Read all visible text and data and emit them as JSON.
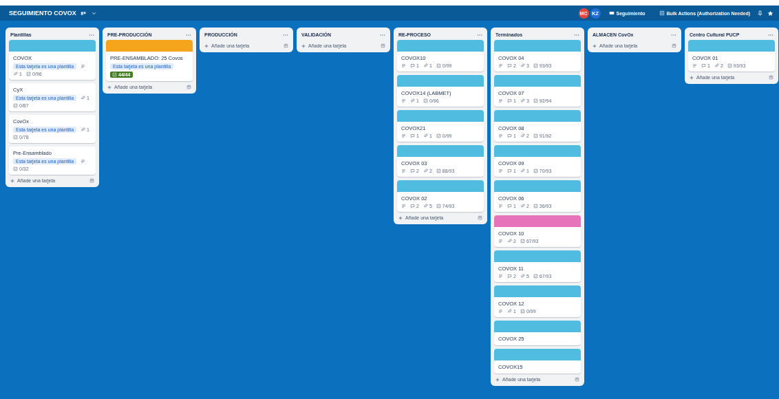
{
  "header": {
    "title": "SEGUIMIENTO COVOX",
    "avatars": [
      {
        "initials": "MC",
        "color": "#e2483d"
      },
      {
        "initials": "KZ",
        "color": "#1f6fd6"
      }
    ],
    "buttons": [
      {
        "kind": "power-up",
        "label": "Seguimiento"
      },
      {
        "kind": "bulk",
        "label": "Bulk Actions (Authorization Needed)"
      }
    ]
  },
  "lists": [
    {
      "title": "Plantillas",
      "add_label": "Añade una tarjeta",
      "cards": [
        {
          "color": "#4fbce0",
          "title": "COVOX",
          "template_badge": "Esta tarjeta es una plantilla",
          "badges": [
            {
              "kind": "description"
            },
            {
              "kind": "attachments",
              "text": "1"
            },
            {
              "kind": "checklist",
              "text": "0/96",
              "complete": false
            }
          ]
        },
        {
          "title": "CyX",
          "template_badge": "Esta tarjeta es una plantilla",
          "badges": [
            {
              "kind": "attachments",
              "text": "1"
            },
            {
              "kind": "checklist",
              "text": "0/87",
              "complete": false
            }
          ]
        },
        {
          "title": "CovOx",
          "template_badge": "Esta tarjeta es una plantilla",
          "badges": [
            {
              "kind": "attachments",
              "text": "1"
            },
            {
              "kind": "checklist",
              "text": "0/78",
              "complete": false
            }
          ]
        },
        {
          "title": "Pre-Ensamblado",
          "template_badge": "Esta tarjeta es una plantilla",
          "badges": [
            {
              "kind": "description"
            },
            {
              "kind": "checklist",
              "text": "0/32",
              "complete": false
            }
          ]
        }
      ]
    },
    {
      "title": "PRE-PRODUCCIÓN",
      "add_label": "Añade una tarjeta",
      "cards": [
        {
          "color": "#f5a51c",
          "title": "PRE-ENSAMBLADO: 25 Covos",
          "template_badge": "Esta tarjeta es una plantilla",
          "badges": [
            {
              "kind": "checklist",
              "text": "44/44",
              "complete": true
            }
          ]
        }
      ]
    },
    {
      "title": "PRODUCCIÓN",
      "add_label": "Añade una tarjeta"
    },
    {
      "title": "VALIDACIÓN",
      "add_label": "Añade una tarjeta"
    },
    {
      "title": "RE-PROCESO",
      "add_label": "Añade una tarjeta",
      "cards": [
        {
          "color": "#4fbce0",
          "title": "COVOX10",
          "badges": [
            {
              "kind": "description"
            },
            {
              "kind": "comments",
              "text": "1"
            },
            {
              "kind": "attachments",
              "text": "1"
            },
            {
              "kind": "checklist",
              "text": "0/99",
              "complete": false
            }
          ]
        },
        {
          "color": "#4fbce0",
          "title": "COVOX14 (LABMET)",
          "badges": [
            {
              "kind": "description"
            },
            {
              "kind": "attachments",
              "text": "1"
            },
            {
              "kind": "checklist",
              "text": "0/96",
              "complete": false
            }
          ]
        },
        {
          "color": "#4fbce0",
          "title": "COVOX21",
          "badges": [
            {
              "kind": "description"
            },
            {
              "kind": "comments",
              "text": "1"
            },
            {
              "kind": "attachments",
              "text": "1"
            },
            {
              "kind": "checklist",
              "text": "0/99",
              "complete": false
            }
          ]
        },
        {
          "color": "#4fbce0",
          "title": "COVOX 03",
          "badges": [
            {
              "kind": "description"
            },
            {
              "kind": "comments",
              "text": "2"
            },
            {
              "kind": "attachments",
              "text": "2"
            },
            {
              "kind": "checklist",
              "text": "88/93",
              "complete": false
            }
          ]
        },
        {
          "color": "#4fbce0",
          "title": "COVOX 02",
          "badges": [
            {
              "kind": "description"
            },
            {
              "kind": "comments",
              "text": "2"
            },
            {
              "kind": "attachments",
              "text": "5"
            },
            {
              "kind": "checklist",
              "text": "74/93",
              "complete": false
            }
          ]
        }
      ]
    },
    {
      "title": "Terminados",
      "add_label": "Añade una tarjeta",
      "cards": [
        {
          "color": "#4fbce0",
          "title": "COVOX 04",
          "badges": [
            {
              "kind": "description"
            },
            {
              "kind": "comments",
              "text": "2"
            },
            {
              "kind": "attachments",
              "text": "3"
            },
            {
              "kind": "checklist",
              "text": "93/93",
              "complete": false
            }
          ]
        },
        {
          "color": "#4fbce0",
          "title": "COVOX 07",
          "badges": [
            {
              "kind": "description"
            },
            {
              "kind": "comments",
              "text": "1"
            },
            {
              "kind": "attachments",
              "text": "3"
            },
            {
              "kind": "checklist",
              "text": "92/94",
              "complete": false
            }
          ]
        },
        {
          "color": "#4fbce0",
          "title": "COVOX 08",
          "badges": [
            {
              "kind": "description"
            },
            {
              "kind": "comments",
              "text": "1"
            },
            {
              "kind": "attachments",
              "text": "2"
            },
            {
              "kind": "checklist",
              "text": "91/92",
              "complete": false
            }
          ]
        },
        {
          "color": "#4fbce0",
          "title": "COVOX 09",
          "badges": [
            {
              "kind": "description"
            },
            {
              "kind": "comments",
              "text": "1"
            },
            {
              "kind": "attachments",
              "text": "1"
            },
            {
              "kind": "checklist",
              "text": "70/93",
              "complete": false
            }
          ]
        },
        {
          "color": "#4fbce0",
          "title": "COVOX 06",
          "badges": [
            {
              "kind": "description"
            },
            {
              "kind": "comments",
              "text": "1"
            },
            {
              "kind": "attachments",
              "text": "2"
            },
            {
              "kind": "checklist",
              "text": "36/93",
              "complete": false
            }
          ]
        },
        {
          "color": "#e774bb",
          "title": "COVOX 10",
          "badges": [
            {
              "kind": "description"
            },
            {
              "kind": "attachments",
              "text": "2"
            },
            {
              "kind": "checklist",
              "text": "67/93",
              "complete": false
            }
          ]
        },
        {
          "color": "#4fbce0",
          "title": "COVOX 11",
          "badges": [
            {
              "kind": "description"
            },
            {
              "kind": "comments",
              "text": "2"
            },
            {
              "kind": "attachments",
              "text": "5"
            },
            {
              "kind": "checklist",
              "text": "67/93",
              "complete": false
            }
          ]
        },
        {
          "color": "#4fbce0",
          "title": "COVOX 12",
          "badges": [
            {
              "kind": "description"
            },
            {
              "kind": "attachments",
              "text": "1"
            },
            {
              "kind": "checklist",
              "text": "0/99",
              "complete": false
            }
          ]
        },
        {
          "color": "#4fbce0",
          "title": "COVOX 25"
        },
        {
          "color": "#4fbce0",
          "title": "COVOX15"
        }
      ]
    },
    {
      "title": "ALMACEN CovOx",
      "add_label": "Añade una tarjeta"
    },
    {
      "title": "Centro Cultural PUCP",
      "add_label": "Añade una tarjeta",
      "cards": [
        {
          "color": "#4fbce0",
          "title": "COVOX 01",
          "badges": [
            {
              "kind": "description"
            },
            {
              "kind": "comments",
              "text": "1"
            },
            {
              "kind": "attachments",
              "text": "2"
            },
            {
              "kind": "checklist",
              "text": "93/93",
              "complete": false
            }
          ]
        }
      ]
    }
  ]
}
